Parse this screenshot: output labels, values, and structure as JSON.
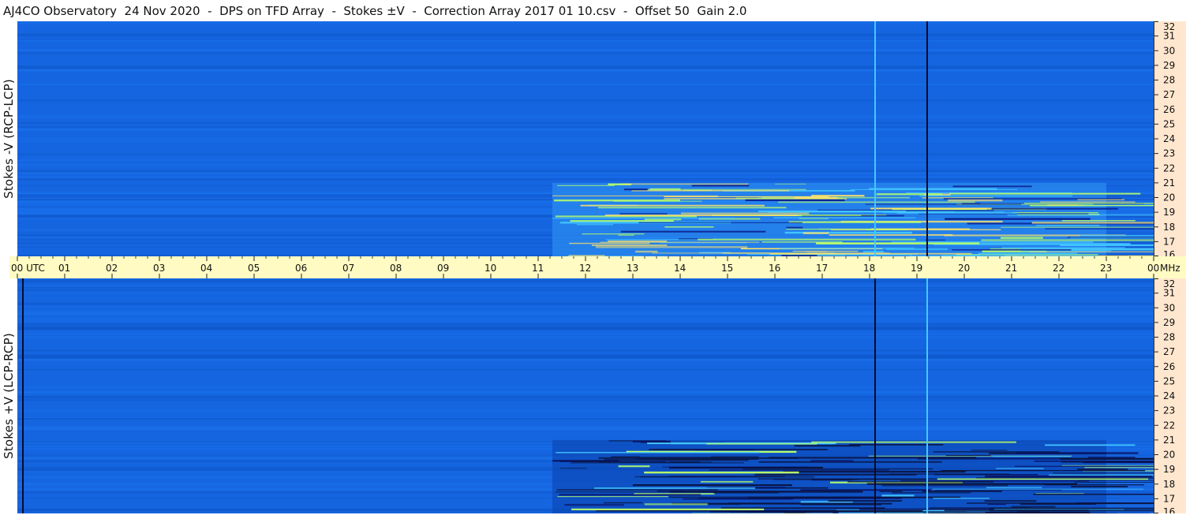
{
  "title": "AJ4CO Observatory  24 Nov 2020  -  DPS on TFD Array  -  Stokes ±V  -  Correction Array 2017 01 10.csv  -  Offset 50  Gain 2.0",
  "colors": {
    "background": "#1565e0",
    "time_axis_bg": "#fffbc2",
    "freq_axis_bg": "#ffe7cf"
  },
  "chart_data": [
    {
      "type": "heatmap",
      "ylabel": "Stokes -V  (RCP-LCP)",
      "x_range_utc": [
        "00",
        "00"
      ],
      "y_range_mhz": [
        16,
        32
      ],
      "ytick_labels": [
        "32",
        "31",
        "30",
        "29",
        "28",
        "27",
        "26",
        "25",
        "24",
        "23",
        "22",
        "21",
        "20",
        "19",
        "18",
        "17",
        "16"
      ],
      "features": [
        {
          "kind": "vertical-line",
          "utc_hour": 18.1,
          "color": "#43c8ff"
        },
        {
          "kind": "vertical-line",
          "utc_hour": 19.2,
          "color": "#0a0a28"
        },
        {
          "kind": "emission-region",
          "utc_hours": [
            11.3,
            23.0
          ],
          "mhz": [
            16,
            21
          ],
          "color": "#b8ff6a"
        }
      ]
    },
    {
      "type": "heatmap",
      "ylabel": "Stokes +V  (LCP-RCP)",
      "x_range_utc": [
        "00",
        "00"
      ],
      "y_range_mhz": [
        16,
        32
      ],
      "ytick_labels": [
        "32",
        "31",
        "30",
        "29",
        "28",
        "27",
        "26",
        "25",
        "24",
        "23",
        "22",
        "21",
        "20",
        "19",
        "18",
        "17",
        "16"
      ],
      "features": [
        {
          "kind": "vertical-line",
          "utc_hour": 0.1,
          "color": "#0a0a28"
        },
        {
          "kind": "vertical-line",
          "utc_hour": 18.1,
          "color": "#0a0a28"
        },
        {
          "kind": "vertical-line",
          "utc_hour": 19.2,
          "color": "#43c8ff"
        },
        {
          "kind": "absorption-region",
          "utc_hours": [
            11.3,
            23.0
          ],
          "mhz": [
            16,
            21
          ],
          "color": "#0a1e8c"
        }
      ]
    }
  ],
  "time_axis": {
    "labels": [
      "00  UTC",
      "01",
      "02",
      "03",
      "04",
      "05",
      "06",
      "07",
      "08",
      "09",
      "10",
      "11",
      "12",
      "13",
      "14",
      "15",
      "16",
      "17",
      "18",
      "19",
      "20",
      "21",
      "22",
      "23",
      "00"
    ],
    "unit": "MHz"
  }
}
